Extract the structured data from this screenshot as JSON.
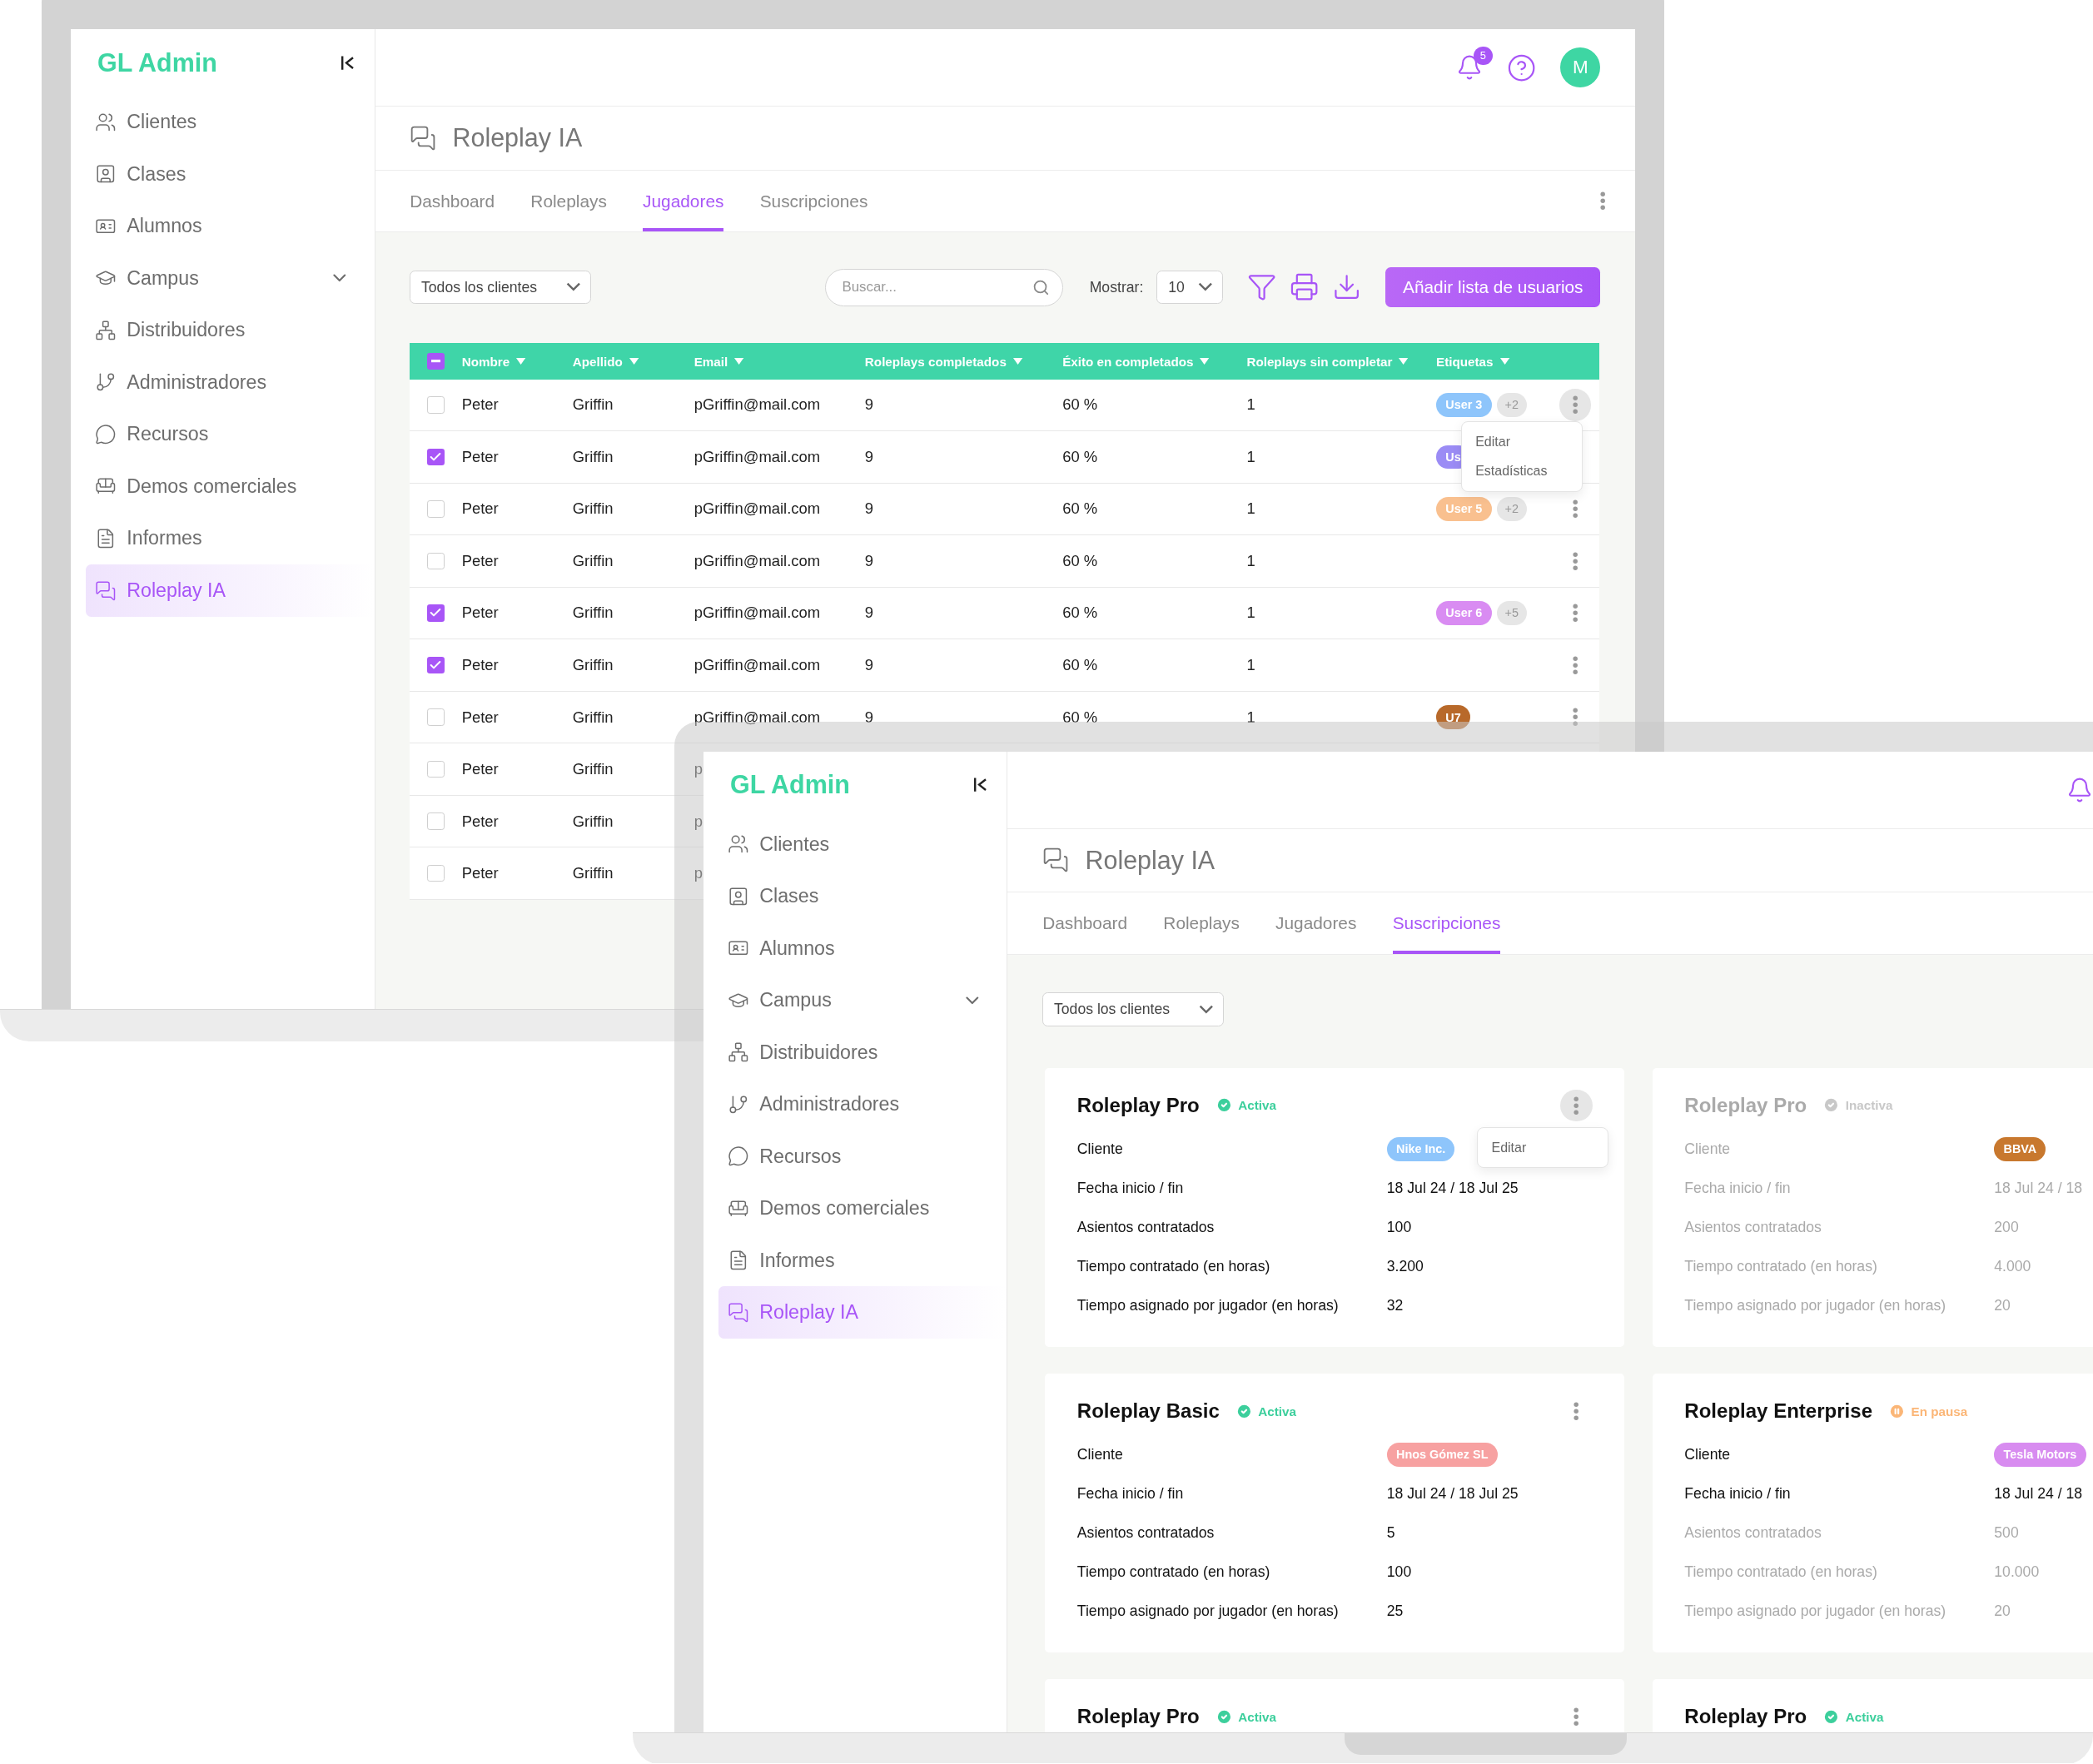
{
  "laptops": [
    {
      "brand": "GL Admin",
      "sidebar": [
        {
          "label": "Clientes",
          "selected": false
        },
        {
          "label": "Clases",
          "selected": false
        },
        {
          "label": "Alumnos",
          "selected": false
        },
        {
          "label": "Campus",
          "selected": false,
          "expanded": false
        },
        {
          "label": "Distribuidores",
          "selected": false
        },
        {
          "label": "Administradores",
          "selected": false
        },
        {
          "label": "Recursos",
          "selected": false
        },
        {
          "label": "Demos comerciales",
          "selected": false
        },
        {
          "label": "Informes",
          "selected": false
        },
        {
          "label": "Roleplay IA",
          "selected": true
        }
      ],
      "notifications": "5",
      "avatar": "M",
      "page_title": "Roleplay IA",
      "tabs": [
        {
          "label": "Dashboard",
          "selected": false
        },
        {
          "label": "Roleplays",
          "selected": false
        },
        {
          "label": "Jugadores",
          "selected": true
        },
        {
          "label": "Suscripciones",
          "selected": false
        }
      ],
      "view": {
        "kind": "table",
        "client_filter": "Todos los clientes",
        "search_placeholder": "Buscar...",
        "show_label": "Mostrar:",
        "show_value": "10",
        "add_button": "Añadir lista de usuarios",
        "select_all_indeterminate": true,
        "columns": [
          "Nombre",
          "Apellido",
          "Email",
          "Roleplays completados",
          "Éxito en completados",
          "Roleplays sin completar",
          "Etiquetas"
        ],
        "rows": [
          {
            "checked": false,
            "cells": [
              "Peter",
              "Griffin",
              "pGriffin@mail.com",
              "9",
              "60 %",
              "1"
            ],
            "tags": [
              {
                "label": "User 3",
                "color": "#8ec5fb"
              }
            ],
            "more": "+2",
            "menu_open": true
          },
          {
            "checked": true,
            "cells": [
              "Peter",
              "Griffin",
              "pGriffin@mail.com",
              "9",
              "60 %",
              "1"
            ],
            "tags": [
              {
                "label": "Us",
                "color": "#9b8cf5"
              }
            ]
          },
          {
            "checked": false,
            "cells": [
              "Peter",
              "Griffin",
              "pGriffin@mail.com",
              "9",
              "60 %",
              "1"
            ],
            "tags": [
              {
                "label": "User 5",
                "color": "#f9c08f"
              }
            ],
            "more": "+2",
            "menu_open": false
          },
          {
            "checked": false,
            "cells": [
              "Peter",
              "Griffin",
              "pGriffin@mail.com",
              "9",
              "60 %",
              "1"
            ],
            "menu_open": false
          },
          {
            "checked": true,
            "cells": [
              "Peter",
              "Griffin",
              "pGriffin@mail.com",
              "9",
              "60 %",
              "1"
            ],
            "tags": [
              {
                "label": "User 6",
                "color": "#d98cf2"
              }
            ],
            "more": "+5",
            "menu_open": false
          },
          {
            "checked": true,
            "cells": [
              "Peter",
              "Griffin",
              "pGriffin@mail.com",
              "9",
              "60 %",
              "1"
            ],
            "menu_open": false
          },
          {
            "checked": false,
            "cells": [
              "Peter",
              "Griffin",
              "pGriffin@mail.com",
              "9",
              "60 %",
              "1"
            ],
            "tags": [
              {
                "label": "U7",
                "color": "#b8692a"
              }
            ],
            "menu_open": false
          },
          {
            "checked": false,
            "cells": [
              "Peter",
              "Griffin",
              "p"
            ]
          },
          {
            "checked": false,
            "cells": [
              "Peter",
              "Griffin",
              "p"
            ]
          },
          {
            "checked": false,
            "cells": [
              "Peter",
              "Griffin",
              "p"
            ]
          }
        ],
        "row_menu": [
          "Editar",
          "Estadísticas"
        ]
      }
    },
    {
      "brand": "GL Admin",
      "sidebar": [
        {
          "label": "Clientes",
          "selected": false
        },
        {
          "label": "Clases",
          "selected": false
        },
        {
          "label": "Alumnos",
          "selected": false
        },
        {
          "label": "Campus",
          "selected": false,
          "expanded": false
        },
        {
          "label": "Distribuidores",
          "selected": false
        },
        {
          "label": "Administradores",
          "selected": false
        },
        {
          "label": "Recursos",
          "selected": false
        },
        {
          "label": "Demos comerciales",
          "selected": false
        },
        {
          "label": "Informes",
          "selected": false
        },
        {
          "label": "Roleplay IA",
          "selected": true
        }
      ],
      "page_title": "Roleplay IA",
      "tabs": [
        {
          "label": "Dashboard",
          "selected": false
        },
        {
          "label": "Roleplays",
          "selected": false
        },
        {
          "label": "Jugadores",
          "selected": false
        },
        {
          "label": "Suscripciones",
          "selected": true
        }
      ],
      "view": {
        "kind": "cards",
        "client_filter": "Todos los clientes",
        "cards": [
          {
            "title": "Roleplay Pro",
            "status": {
              "kind": "active",
              "label": "Activa"
            },
            "menu": {
              "open": true,
              "items": [
                "Editar"
              ]
            },
            "fields": [
              {
                "kind": "tag",
                "label": "Cliente",
                "value": "Nike Inc.",
                "color": "#8ec5fb",
                "muted": false
              },
              {
                "kind": "text",
                "label": "Fecha inicio / fin",
                "value": "18 Jul 24 / 18 Jul 25",
                "muted": false
              },
              {
                "kind": "text",
                "label": "Asientos contratados",
                "value": "100",
                "muted": false
              },
              {
                "kind": "text",
                "label": "Tiempo contratado (en horas)",
                "value": "3.200",
                "muted": false
              },
              {
                "kind": "text",
                "label": "Tiempo asignado por jugador (en horas)",
                "value": "32",
                "muted": false
              }
            ]
          },
          {
            "title": "Roleplay Pro",
            "status": {
              "kind": "inactive",
              "label": "Inactiva"
            },
            "fields": [
              {
                "kind": "tag",
                "label": "Cliente",
                "value": "BBVA",
                "color": "#c8782e",
                "muted": true
              },
              {
                "kind": "text",
                "label": "Fecha inicio / fin",
                "value": "18 Jul 24 / 18",
                "muted": true
              },
              {
                "kind": "text",
                "label": "Asientos contratados",
                "value": "200",
                "muted": true
              },
              {
                "kind": "text",
                "label": "Tiempo contratado (en horas)",
                "value": "4.000",
                "muted": true
              },
              {
                "kind": "text",
                "label": "Tiempo asignado por jugador (en horas)",
                "value": "20",
                "muted": true
              }
            ]
          },
          {
            "title": "Roleplay Basic",
            "status": {
              "kind": "active",
              "label": "Activa"
            },
            "menu": {
              "open": false
            },
            "fields": [
              {
                "kind": "tag",
                "label": "Cliente",
                "value": "Hnos Gómez SL",
                "color": "#f7a1a1",
                "muted": false
              },
              {
                "kind": "text",
                "label": "Fecha inicio / fin",
                "value": "18 Jul 24 / 18 Jul 25",
                "muted": false
              },
              {
                "kind": "text",
                "label": "Asientos contratados",
                "value": "5",
                "muted": false
              },
              {
                "kind": "text",
                "label": "Tiempo contratado (en horas)",
                "value": "100",
                "muted": false
              },
              {
                "kind": "text",
                "label": "Tiempo asignado por jugador (en horas)",
                "value": "25",
                "muted": false
              }
            ]
          },
          {
            "title": "Roleplay Enterprise",
            "status": {
              "kind": "paused",
              "label": "En pausa"
            },
            "fields": [
              {
                "kind": "tag",
                "label": "Cliente",
                "value": "Tesla Motors",
                "color": "#d88cf0",
                "muted": false
              },
              {
                "kind": "text",
                "label": "Fecha inicio / fin",
                "value": "18 Jul 24 / 18",
                "muted": false
              },
              {
                "kind": "text",
                "label": "Asientos contratados",
                "value": "500",
                "muted": true
              },
              {
                "kind": "text",
                "label": "Tiempo contratado (en horas)",
                "value": "10.000",
                "muted": true
              },
              {
                "kind": "text",
                "label": "Tiempo asignado por jugador (en horas)",
                "value": "20",
                "muted": true
              }
            ]
          },
          {
            "title": "Roleplay Pro",
            "status": {
              "kind": "active",
              "label": "Activa"
            },
            "menu": {
              "open": false
            }
          },
          {
            "title": "Roleplay Pro",
            "status": {
              "kind": "active",
              "label": "Activa"
            }
          }
        ]
      }
    }
  ]
}
